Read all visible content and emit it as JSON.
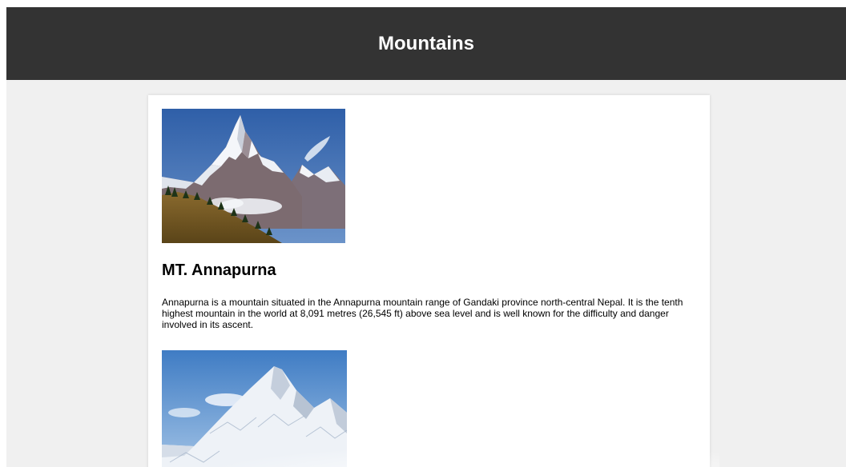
{
  "header": {
    "title": "Mountains"
  },
  "mountains": [
    {
      "name": "MT. Annapurna",
      "description": "Annapurna is a mountain situated in the Annapurna mountain range of Gandaki province north-central Nepal. It is the tenth highest mountain in the world at 8,091 metres (26,545 ft) above sea level and is well known for the difficulty and danger involved in its ascent.",
      "image": "annapurna-photo"
    },
    {
      "image": "snowy-peak-photo"
    }
  ],
  "colors": {
    "header_bg": "#333333",
    "page_bg": "#f0f0f0",
    "card_bg": "#ffffff"
  }
}
